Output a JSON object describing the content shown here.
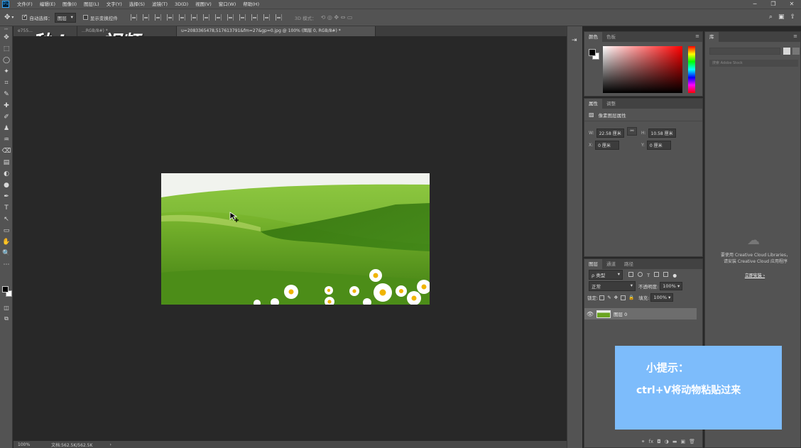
{
  "menubar": {
    "logo": "Ps",
    "items": [
      "文件(F)",
      "编辑(E)",
      "图像(I)",
      "图层(L)",
      "文字(Y)",
      "选择(S)",
      "滤镜(T)",
      "3D(D)",
      "视图(V)",
      "窗口(W)",
      "帮助(H)"
    ],
    "win_minimize": "─",
    "win_restore": "❐",
    "win_close": "✕"
  },
  "optionsbar": {
    "auto_select_label": "自动选择：",
    "auto_select_value": "图层",
    "show_transform_label": "显示变换控件",
    "mode_3d_label": "3D 模式："
  },
  "toolbar": {
    "tools": [
      "✥",
      "⬚",
      "◯",
      "✦",
      "⌗",
      "✎",
      "✚",
      "✐",
      "♟",
      "♒",
      "⌫",
      "▤",
      "◐",
      "●",
      "✒",
      "T",
      "↖",
      "▭",
      "✋",
      "🔍",
      "⋯"
    ]
  },
  "doctabs": [
    "e755...",
    "...RGB/8#) *",
    "u=2083365478,517613791&fm=27&gp=0.jpg @ 100% (图层 0, RGB/8#) *"
  ],
  "watermark": "秒dong视频",
  "statusbar": {
    "zoom": "100%",
    "doc_info": "文档:562.5K/562.5K",
    "arrow": "›"
  },
  "color_panel": {
    "tabs": [
      "颜色",
      "色板"
    ],
    "menu": "≡"
  },
  "properties_panel": {
    "tabs": [
      "属性",
      "调整"
    ],
    "subtitle": "像素图层属性",
    "w_label": "W:",
    "w_value": "22.58 厘米",
    "link_icon": "⚯",
    "h_label": "H:",
    "h_value": "10.58 厘米",
    "x_label": "X:",
    "x_value": "0 厘米",
    "y_label": "Y:",
    "y_value": "0 厘米"
  },
  "layers_panel": {
    "tabs": [
      "图层",
      "通道",
      "路径"
    ],
    "filter_kind": "ρ 类型",
    "blend_mode": "正常",
    "opacity_label": "不透明度:",
    "opacity_value": "100%",
    "lock_label": "锁定:",
    "fill_label": "填充:",
    "fill_value": "100%",
    "layer_name": "图层 0",
    "footer_icons": [
      "⚭",
      "fx",
      "◘",
      "◑",
      "▬",
      "▣",
      "🗑"
    ]
  },
  "library_panel": {
    "tab": "库",
    "search_placeholder": "搜索 Adobe Stock",
    "cc_message_line1": "要使用 Creative Cloud Libraries，",
    "cc_message_line2": "请安装 Creative Cloud 应用程序",
    "cc_link": "立即安装 ›"
  },
  "hint": {
    "title": "小提示：",
    "body": "ctrl+V将动物粘贴过来"
  },
  "colors": {
    "hint_bg": "#7dbcfb",
    "app_bg": "#535353",
    "canvas_bg": "#282828"
  }
}
